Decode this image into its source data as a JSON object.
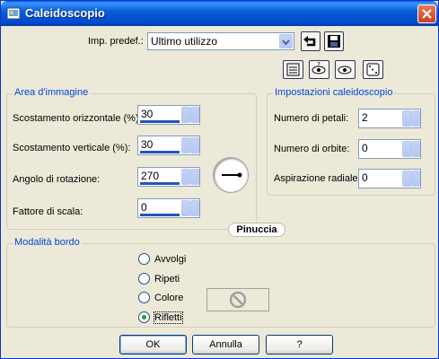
{
  "window": {
    "title": "Caleidoscopio",
    "icons": {
      "app": "app-icon",
      "close": "close-icon"
    }
  },
  "preset": {
    "label": "Imp. predef.:",
    "value": "Ultimo utilizzo"
  },
  "area": {
    "title": "Area d'immagine",
    "fields": [
      {
        "label": "Scostamento orizzontale (%):",
        "value": "30"
      },
      {
        "label": "Scostamento verticale (%):",
        "value": "30"
      },
      {
        "label": "Angolo di rotazione:",
        "value": "270"
      },
      {
        "label": "Fattore di scala:",
        "value": "0"
      }
    ]
  },
  "settings": {
    "title": "Impostazioni caleidoscopio",
    "fields": [
      {
        "label": "Numero di petali:",
        "value": "2"
      },
      {
        "label": "Numero di orbite:",
        "value": "0"
      },
      {
        "label": "Aspirazione radiale:",
        "value": "0"
      }
    ]
  },
  "border": {
    "title": "Modalità bordo",
    "options": [
      {
        "label": "Avvolgi",
        "checked": false
      },
      {
        "label": "Ripeti",
        "checked": false
      },
      {
        "label": "Colore",
        "checked": false
      },
      {
        "label": "Rifletti",
        "checked": true
      }
    ]
  },
  "watermark": "Pinuccia",
  "buttons": {
    "ok": "OK",
    "cancel": "Annulla",
    "help": "?"
  }
}
